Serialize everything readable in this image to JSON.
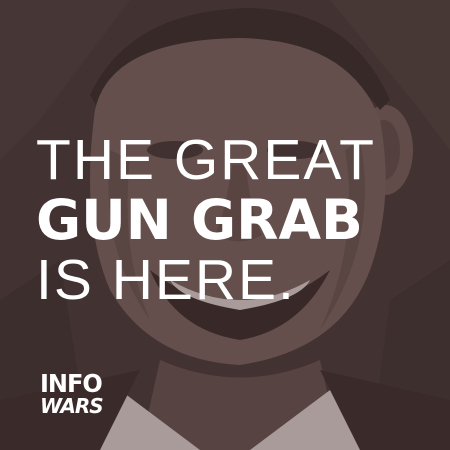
{
  "headline": {
    "line1": "THE GREAT",
    "line2": "GUN GRAB",
    "line3": "IS HERE."
  },
  "logo": {
    "top": "INFO",
    "bottom": "WARS"
  },
  "colors": {
    "background": "#3a2e2d",
    "tint": "#503a38",
    "text": "#ffffff"
  }
}
